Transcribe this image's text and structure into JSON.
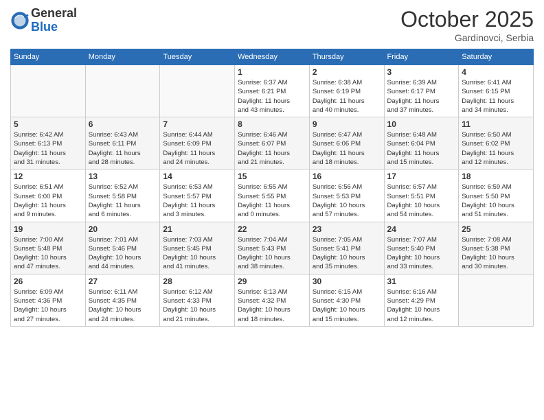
{
  "header": {
    "logo_general": "General",
    "logo_blue": "Blue",
    "month": "October 2025",
    "location": "Gardinovci, Serbia"
  },
  "weekdays": [
    "Sunday",
    "Monday",
    "Tuesday",
    "Wednesday",
    "Thursday",
    "Friday",
    "Saturday"
  ],
  "weeks": [
    [
      {
        "day": "",
        "info": ""
      },
      {
        "day": "",
        "info": ""
      },
      {
        "day": "",
        "info": ""
      },
      {
        "day": "1",
        "info": "Sunrise: 6:37 AM\nSunset: 6:21 PM\nDaylight: 11 hours\nand 43 minutes."
      },
      {
        "day": "2",
        "info": "Sunrise: 6:38 AM\nSunset: 6:19 PM\nDaylight: 11 hours\nand 40 minutes."
      },
      {
        "day": "3",
        "info": "Sunrise: 6:39 AM\nSunset: 6:17 PM\nDaylight: 11 hours\nand 37 minutes."
      },
      {
        "day": "4",
        "info": "Sunrise: 6:41 AM\nSunset: 6:15 PM\nDaylight: 11 hours\nand 34 minutes."
      }
    ],
    [
      {
        "day": "5",
        "info": "Sunrise: 6:42 AM\nSunset: 6:13 PM\nDaylight: 11 hours\nand 31 minutes."
      },
      {
        "day": "6",
        "info": "Sunrise: 6:43 AM\nSunset: 6:11 PM\nDaylight: 11 hours\nand 28 minutes."
      },
      {
        "day": "7",
        "info": "Sunrise: 6:44 AM\nSunset: 6:09 PM\nDaylight: 11 hours\nand 24 minutes."
      },
      {
        "day": "8",
        "info": "Sunrise: 6:46 AM\nSunset: 6:07 PM\nDaylight: 11 hours\nand 21 minutes."
      },
      {
        "day": "9",
        "info": "Sunrise: 6:47 AM\nSunset: 6:06 PM\nDaylight: 11 hours\nand 18 minutes."
      },
      {
        "day": "10",
        "info": "Sunrise: 6:48 AM\nSunset: 6:04 PM\nDaylight: 11 hours\nand 15 minutes."
      },
      {
        "day": "11",
        "info": "Sunrise: 6:50 AM\nSunset: 6:02 PM\nDaylight: 11 hours\nand 12 minutes."
      }
    ],
    [
      {
        "day": "12",
        "info": "Sunrise: 6:51 AM\nSunset: 6:00 PM\nDaylight: 11 hours\nand 9 minutes."
      },
      {
        "day": "13",
        "info": "Sunrise: 6:52 AM\nSunset: 5:58 PM\nDaylight: 11 hours\nand 6 minutes."
      },
      {
        "day": "14",
        "info": "Sunrise: 6:53 AM\nSunset: 5:57 PM\nDaylight: 11 hours\nand 3 minutes."
      },
      {
        "day": "15",
        "info": "Sunrise: 6:55 AM\nSunset: 5:55 PM\nDaylight: 11 hours\nand 0 minutes."
      },
      {
        "day": "16",
        "info": "Sunrise: 6:56 AM\nSunset: 5:53 PM\nDaylight: 10 hours\nand 57 minutes."
      },
      {
        "day": "17",
        "info": "Sunrise: 6:57 AM\nSunset: 5:51 PM\nDaylight: 10 hours\nand 54 minutes."
      },
      {
        "day": "18",
        "info": "Sunrise: 6:59 AM\nSunset: 5:50 PM\nDaylight: 10 hours\nand 51 minutes."
      }
    ],
    [
      {
        "day": "19",
        "info": "Sunrise: 7:00 AM\nSunset: 5:48 PM\nDaylight: 10 hours\nand 47 minutes."
      },
      {
        "day": "20",
        "info": "Sunrise: 7:01 AM\nSunset: 5:46 PM\nDaylight: 10 hours\nand 44 minutes."
      },
      {
        "day": "21",
        "info": "Sunrise: 7:03 AM\nSunset: 5:45 PM\nDaylight: 10 hours\nand 41 minutes."
      },
      {
        "day": "22",
        "info": "Sunrise: 7:04 AM\nSunset: 5:43 PM\nDaylight: 10 hours\nand 38 minutes."
      },
      {
        "day": "23",
        "info": "Sunrise: 7:05 AM\nSunset: 5:41 PM\nDaylight: 10 hours\nand 35 minutes."
      },
      {
        "day": "24",
        "info": "Sunrise: 7:07 AM\nSunset: 5:40 PM\nDaylight: 10 hours\nand 33 minutes."
      },
      {
        "day": "25",
        "info": "Sunrise: 7:08 AM\nSunset: 5:38 PM\nDaylight: 10 hours\nand 30 minutes."
      }
    ],
    [
      {
        "day": "26",
        "info": "Sunrise: 6:09 AM\nSunset: 4:36 PM\nDaylight: 10 hours\nand 27 minutes."
      },
      {
        "day": "27",
        "info": "Sunrise: 6:11 AM\nSunset: 4:35 PM\nDaylight: 10 hours\nand 24 minutes."
      },
      {
        "day": "28",
        "info": "Sunrise: 6:12 AM\nSunset: 4:33 PM\nDaylight: 10 hours\nand 21 minutes."
      },
      {
        "day": "29",
        "info": "Sunrise: 6:13 AM\nSunset: 4:32 PM\nDaylight: 10 hours\nand 18 minutes."
      },
      {
        "day": "30",
        "info": "Sunrise: 6:15 AM\nSunset: 4:30 PM\nDaylight: 10 hours\nand 15 minutes."
      },
      {
        "day": "31",
        "info": "Sunrise: 6:16 AM\nSunset: 4:29 PM\nDaylight: 10 hours\nand 12 minutes."
      },
      {
        "day": "",
        "info": ""
      }
    ]
  ]
}
